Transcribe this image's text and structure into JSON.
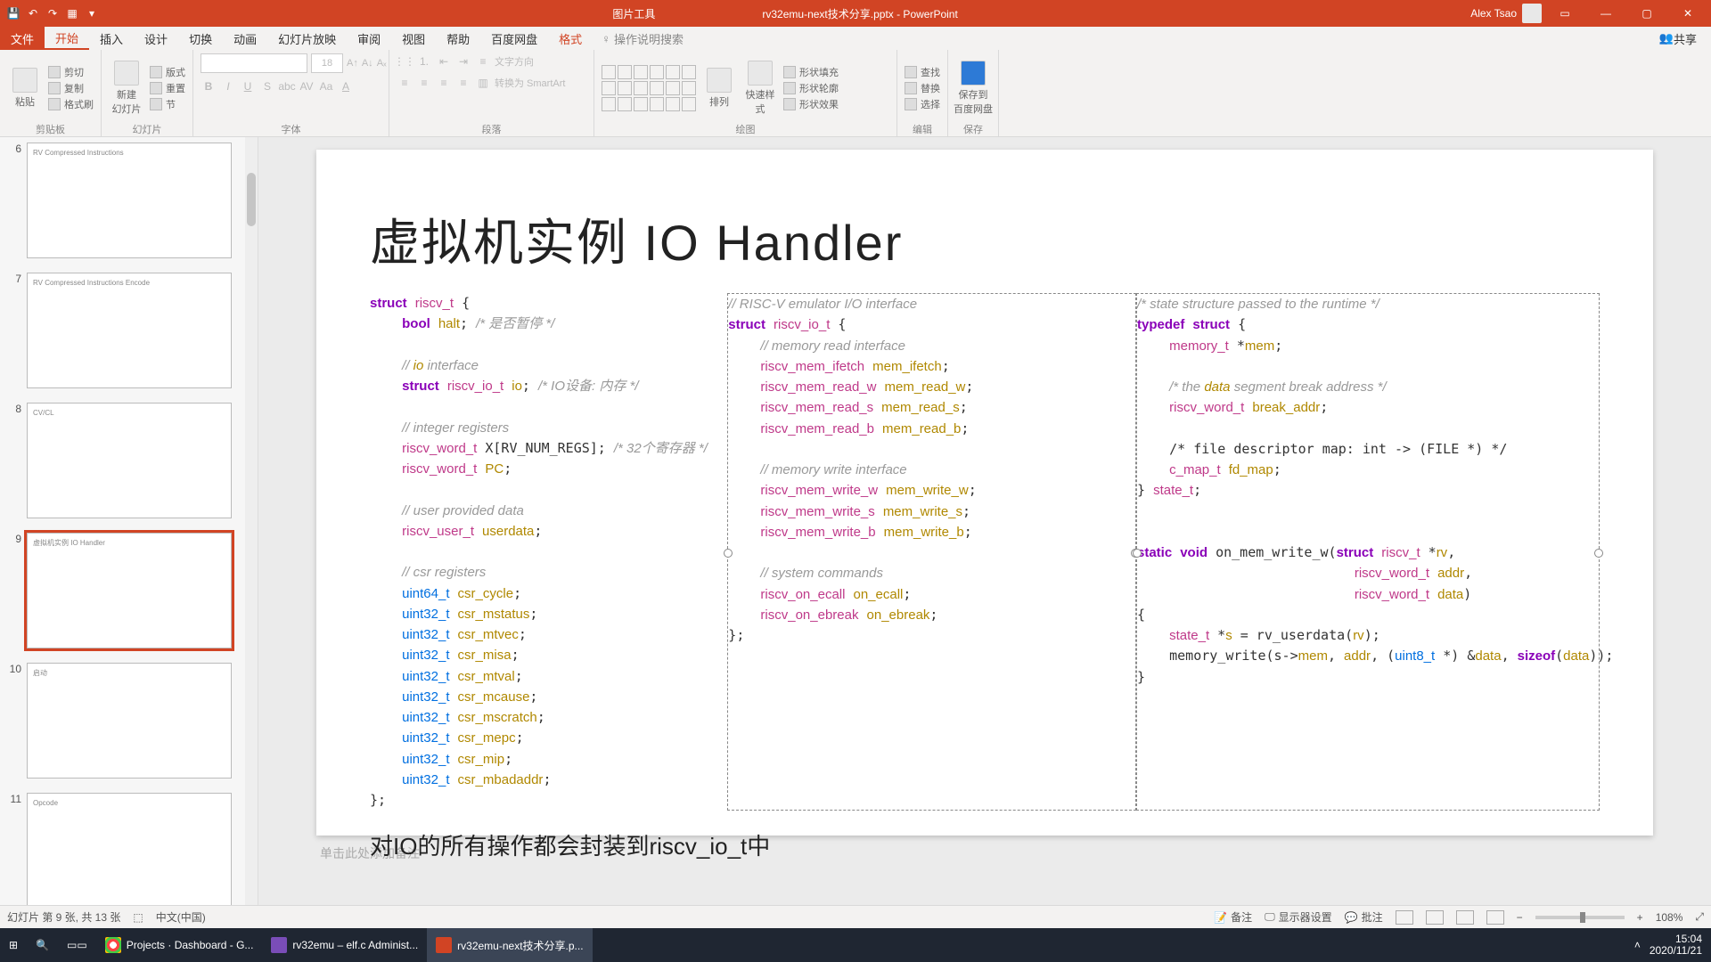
{
  "titlebar": {
    "context_tool": "图片工具",
    "filename": "rv32emu-next技术分享.pptx - PowerPoint",
    "user": "Alex Tsao"
  },
  "tabs": {
    "file": "文件",
    "home": "开始",
    "insert": "插入",
    "design": "设计",
    "transitions": "切换",
    "animations": "动画",
    "slideshow": "幻灯片放映",
    "review": "审阅",
    "view": "视图",
    "help": "帮助",
    "baidu": "百度网盘",
    "format": "格式",
    "tellme": "操作说明搜索",
    "share": "共享"
  },
  "ribbon": {
    "clipboard_label": "剪贴板",
    "paste": "粘贴",
    "cut": "剪切",
    "copy": "复制",
    "formatpaint": "格式刷",
    "slides_label": "幻灯片",
    "newslide": "新建\n幻灯片",
    "layout": "版式",
    "reset": "重置",
    "section": "节",
    "font_label": "字体",
    "font_size": "18",
    "paragraph_label": "段落",
    "textdir": "文字方向",
    "smartart": "转换为 SmartArt",
    "drawing_label": "绘图",
    "arrange": "排列",
    "quickstyle": "快速样式",
    "shapefill": "形状填充",
    "shapeoutline": "形状轮廓",
    "shapeeffects": "形状效果",
    "editing_label": "编辑",
    "find": "查找",
    "replace": "替换",
    "select": "选择",
    "save_label": "保存",
    "saveto": "保存到\n百度网盘"
  },
  "thumbs": [
    {
      "n": "6",
      "title": "RV Compressed Instructions"
    },
    {
      "n": "7",
      "title": "RV Compressed Instructions Encode"
    },
    {
      "n": "8",
      "title": "CV/CL"
    },
    {
      "n": "9",
      "title": "虚拟机实例 IO Handler"
    },
    {
      "n": "10",
      "title": "启动"
    },
    {
      "n": "11",
      "title": "Opcode"
    }
  ],
  "slide": {
    "title": "虚拟机实例 IO Handler",
    "col1_code": "struct riscv_t {\n    bool halt; /* 是否暂停 */\n\n    // io interface\n    struct riscv_io_t io; /* IO设备: 内存 */\n\n    // integer registers\n    riscv_word_t X[RV_NUM_REGS]; /* 32个寄存器 */\n    riscv_word_t PC;\n\n    // user provided data\n    riscv_user_t userdata;\n\n    // csr registers\n    uint64_t csr_cycle;\n    uint32_t csr_mstatus;\n    uint32_t csr_mtvec;\n    uint32_t csr_misa;\n    uint32_t csr_mtval;\n    uint32_t csr_mcause;\n    uint32_t csr_mscratch;\n    uint32_t csr_mepc;\n    uint32_t csr_mip;\n    uint32_t csr_mbadaddr;\n};",
    "col2_code": "// RISC-V emulator I/O interface\nstruct riscv_io_t {\n    // memory read interface\n    riscv_mem_ifetch mem_ifetch;\n    riscv_mem_read_w mem_read_w;\n    riscv_mem_read_s mem_read_s;\n    riscv_mem_read_b mem_read_b;\n\n    // memory write interface\n    riscv_mem_write_w mem_write_w;\n    riscv_mem_write_s mem_write_s;\n    riscv_mem_write_b mem_write_b;\n\n    // system commands\n    riscv_on_ecall on_ecall;\n    riscv_on_ebreak on_ebreak;\n};",
    "col3_code": "/* state structure passed to the runtime */\ntypedef struct {\n    memory_t *mem;\n\n    /* the data segment break address */\n    riscv_word_t break_addr;\n\n    /* file descriptor map: int -> (FILE *) */\n    c_map_t fd_map;\n} state_t;\n\n\nstatic void on_mem_write_w(struct riscv_t *rv,\n                           riscv_word_t addr,\n                           riscv_word_t data)\n{\n    state_t *s = rv_userdata(rv);\n    memory_write(s->mem, addr, (uint8_t *) &data, sizeof(data));\n}",
    "footnote": "对IO的所有操作都会封装到riscv_io_t中"
  },
  "notes_placeholder": "单击此处添加备注",
  "status": {
    "slide_of": "幻灯片 第 9 张, 共 13 张",
    "lang": "中文(中国)",
    "notes": "备注",
    "display": "显示器设置",
    "comments": "批注",
    "zoom": "108%"
  },
  "taskbar": {
    "chrome": "Projects · Dashboard - G...",
    "vs": "rv32emu – elf.c Administ...",
    "pp": "rv32emu-next技术分享.p...",
    "time": "15:04",
    "date": "2020/11/21"
  }
}
